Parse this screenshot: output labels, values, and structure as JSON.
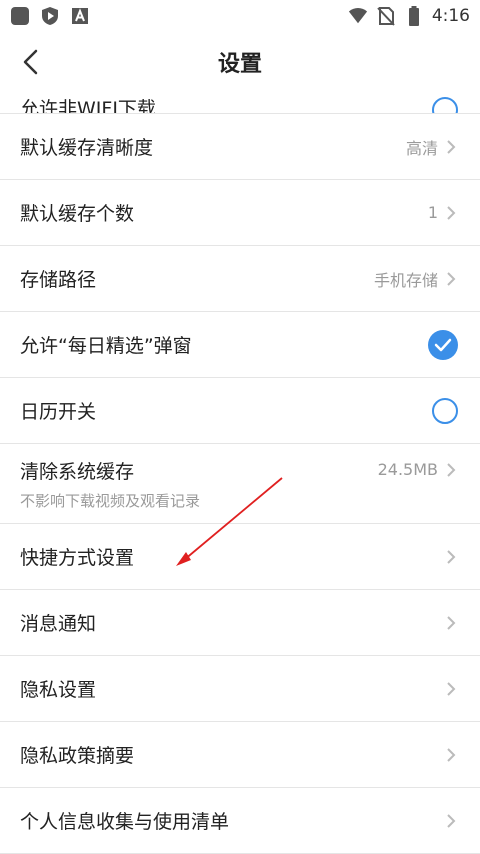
{
  "status_bar": {
    "time": "4:16",
    "left_icons": [
      "app-square-icon",
      "shield-play-icon",
      "font-a-icon"
    ],
    "right_icons": [
      "wifi-icon",
      "no-sim-icon",
      "battery-icon"
    ]
  },
  "header": {
    "title": "设置"
  },
  "settings": {
    "wifi_download": {
      "label": "允许非WIFI下载",
      "enabled": false
    },
    "cache_quality": {
      "label": "默认缓存清晰度",
      "value": "高清"
    },
    "cache_count": {
      "label": "默认缓存个数",
      "value": "1"
    },
    "storage_path": {
      "label": "存储路径",
      "value": "手机存储"
    },
    "daily_popup": {
      "label": "允许“每日精选”弹窗",
      "enabled": true
    },
    "calendar": {
      "label": "日历开关",
      "enabled": false
    },
    "clear_cache": {
      "label": "清除系统缓存",
      "sublabel": "不影响下载视频及观看记录",
      "value": "24.5MB"
    },
    "shortcut": {
      "label": "快捷方式设置"
    },
    "notifications": {
      "label": "消息通知"
    },
    "privacy_settings": {
      "label": "隐私设置"
    },
    "privacy_summary": {
      "label": "隐私政策摘要"
    },
    "personal_info": {
      "label": "个人信息收集与使用清单"
    }
  },
  "colors": {
    "accent": "#3b8fe8",
    "annotation": "#e02020",
    "secondary_text": "#9a9a9a"
  }
}
